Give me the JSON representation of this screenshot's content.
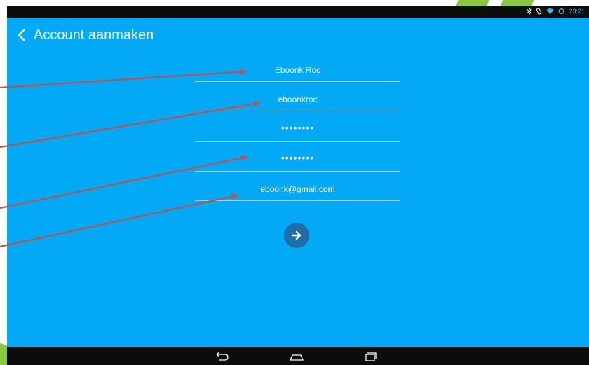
{
  "status_bar": {
    "time": "23:21",
    "icons": [
      "bluetooth-icon",
      "vibrate-icon",
      "wifi-icon",
      "sync-icon"
    ],
    "icon_color": "#33b5e5"
  },
  "app_bar": {
    "back_icon": "chevron-left-icon",
    "title": "Account aanmaken"
  },
  "form": {
    "fields": [
      {
        "name": "name",
        "value": "Eboonk Roc"
      },
      {
        "name": "username",
        "value": "eboonkroc"
      },
      {
        "name": "password",
        "value": "••••••••"
      },
      {
        "name": "password_confirm",
        "value": "••••••••"
      },
      {
        "name": "email",
        "value": "eboonk@gmail.com"
      }
    ],
    "submit_icon": "arrow-right-icon"
  },
  "nav_bar": {
    "buttons": [
      "back-nav-icon",
      "home-nav-icon",
      "recents-nav-icon"
    ]
  },
  "colors": {
    "background": "#03a9f4",
    "submit_button": "#1d6fa8",
    "annotation_arrow": "#c0504d",
    "decoration": "#8ac83f"
  }
}
